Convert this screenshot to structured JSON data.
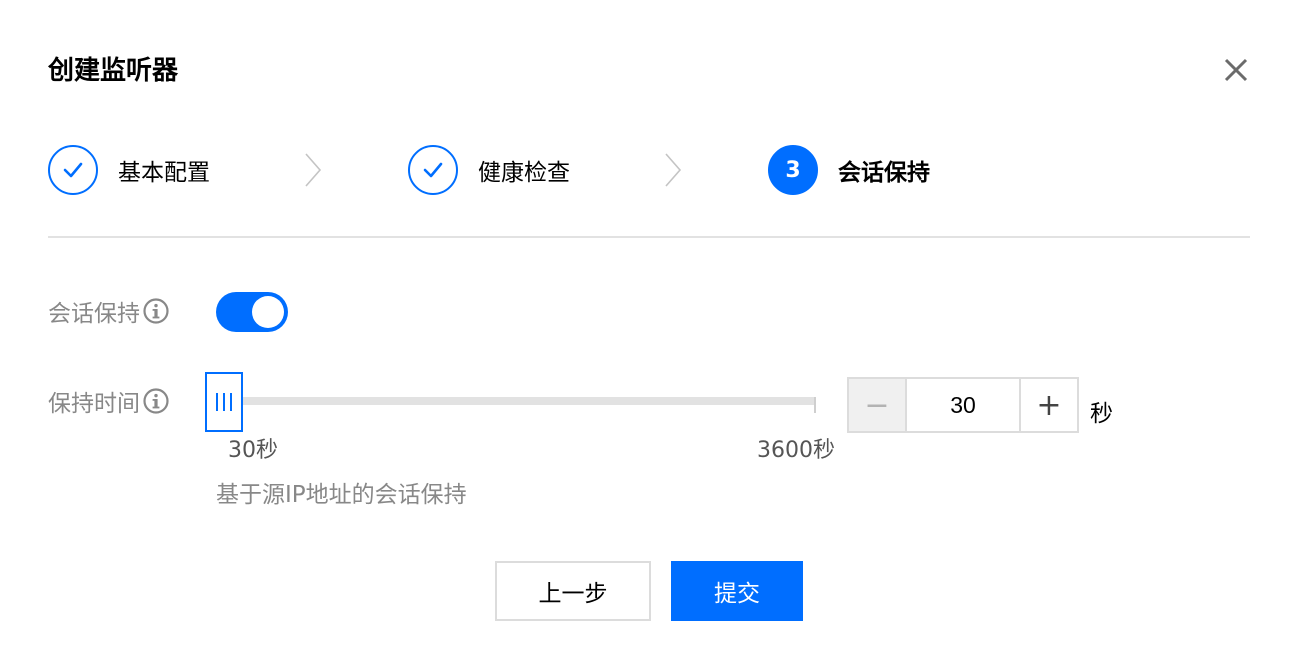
{
  "dialog": {
    "title": "创建监听器"
  },
  "steps": [
    {
      "label": "基本配置",
      "status": "done",
      "icon": "check-icon"
    },
    {
      "label": "健康检查",
      "status": "done",
      "icon": "check-icon"
    },
    {
      "label": "会话保持",
      "status": "active",
      "number": "3"
    }
  ],
  "form": {
    "session_persistence": {
      "label": "会话保持",
      "info_icon": "info-icon",
      "enabled": true
    },
    "hold_time": {
      "label": "保持时间",
      "info_icon": "info-icon",
      "slider_min_label": "30秒",
      "slider_max_label": "3600秒",
      "min": 30,
      "max": 3600,
      "value": 30,
      "stepper_value": "30",
      "minus_symbol": "−",
      "plus_symbol": "+",
      "unit": "秒"
    },
    "hint": "基于源IP地址的会话保持"
  },
  "footer": {
    "prev_label": "上一步",
    "submit_label": "提交"
  },
  "colors": {
    "accent": "#006eff",
    "label_gray": "#888888",
    "divider": "#e2e2e2"
  }
}
